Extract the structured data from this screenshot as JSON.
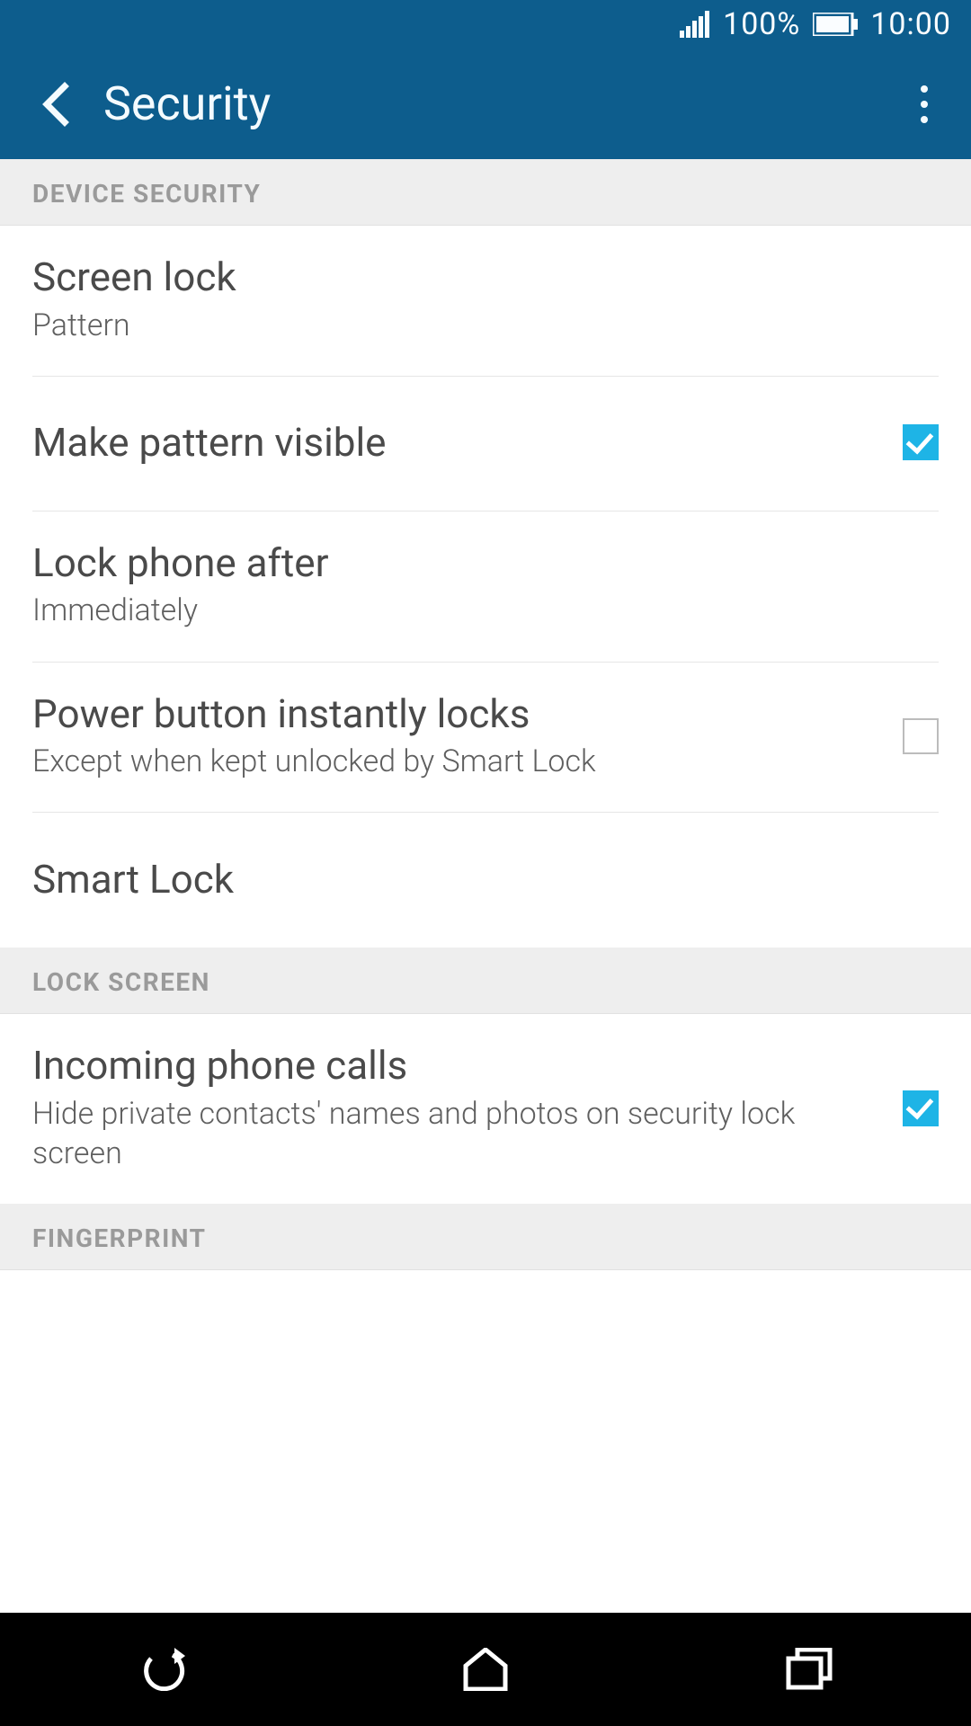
{
  "status_bar": {
    "battery_pct": "100%",
    "clock": "10:00"
  },
  "app_bar": {
    "title": "Security"
  },
  "sections": {
    "device_security": {
      "header": "DEVICE SECURITY",
      "screen_lock": {
        "title": "Screen lock",
        "value": "Pattern"
      },
      "pattern_visible": {
        "title": "Make pattern visible",
        "checked": true
      },
      "lock_after": {
        "title": "Lock phone after",
        "value": "Immediately"
      },
      "power_lock": {
        "title": "Power button instantly locks",
        "sub": "Except when kept unlocked by Smart Lock",
        "checked": false
      },
      "smart_lock": {
        "title": "Smart Lock"
      }
    },
    "lock_screen": {
      "header": "LOCK SCREEN",
      "incoming_calls": {
        "title": "Incoming phone calls",
        "sub": "Hide private contacts' names and photos on security lock screen",
        "checked": true
      }
    },
    "fingerprint": {
      "header": "FINGERPRINT"
    }
  }
}
